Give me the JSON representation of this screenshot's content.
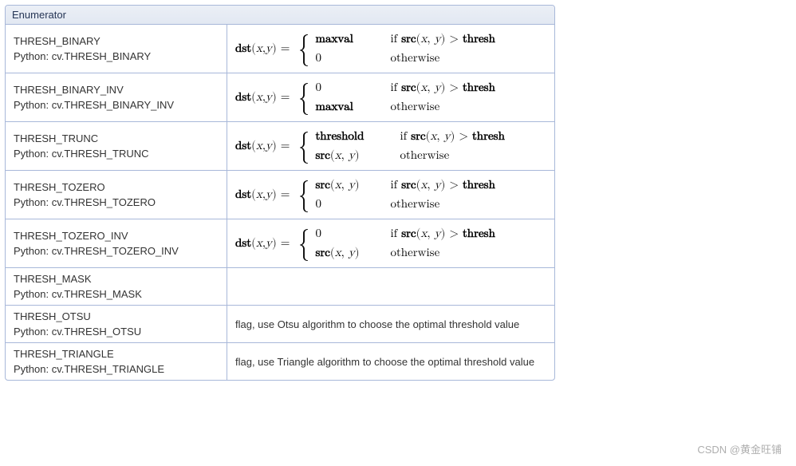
{
  "header": "Enumerator",
  "rows": [
    {
      "name": "THRESH_BINARY",
      "python": "Python: cv.THRESH_BINARY",
      "formula": {
        "lhs": "dst(x, y) = ",
        "case1_val": "maxval",
        "case1_val_bold": true,
        "case1_cond": "if src(x, y) > thresh",
        "case2_val": "0",
        "case2_val_bold": false,
        "case2_cond": "otherwise",
        "wide": false
      }
    },
    {
      "name": "THRESH_BINARY_INV",
      "python": "Python: cv.THRESH_BINARY_INV",
      "formula": {
        "lhs": "dst(x, y) = ",
        "case1_val": "0",
        "case1_val_bold": false,
        "case1_cond": "if src(x, y) > thresh",
        "case2_val": "maxval",
        "case2_val_bold": true,
        "case2_cond": "otherwise",
        "wide": false
      }
    },
    {
      "name": "THRESH_TRUNC",
      "python": "Python: cv.THRESH_TRUNC",
      "formula": {
        "lhs": "dst(x, y) = ",
        "case1_val": "threshold",
        "case1_val_bold": true,
        "case1_cond": "if src(x, y) > thresh",
        "case2_val": "src(x, y)",
        "case2_val_bold": true,
        "case2_cond": "otherwise",
        "wide": true
      }
    },
    {
      "name": "THRESH_TOZERO",
      "python": "Python: cv.THRESH_TOZERO",
      "formula": {
        "lhs": "dst(x, y) = ",
        "case1_val": "src(x, y)",
        "case1_val_bold": true,
        "case1_cond": "if src(x, y) > thresh",
        "case2_val": "0",
        "case2_val_bold": false,
        "case2_cond": "otherwise",
        "wide": false
      }
    },
    {
      "name": "THRESH_TOZERO_INV",
      "python": "Python: cv.THRESH_TOZERO_INV",
      "formula": {
        "lhs": "dst(x, y) = ",
        "case1_val": "0",
        "case1_val_bold": false,
        "case1_cond": "if src(x, y) > thresh",
        "case2_val": "src(x, y)",
        "case2_val_bold": true,
        "case2_cond": "otherwise",
        "wide": false
      }
    },
    {
      "name": "THRESH_MASK",
      "python": "Python: cv.THRESH_MASK",
      "desc": ""
    },
    {
      "name": "THRESH_OTSU",
      "python": "Python: cv.THRESH_OTSU",
      "desc": "flag, use Otsu algorithm to choose the optimal threshold value"
    },
    {
      "name": "THRESH_TRIANGLE",
      "python": "Python: cv.THRESH_TRIANGLE",
      "desc": "flag, use Triangle algorithm to choose the optimal threshold value"
    }
  ],
  "watermark": "CSDN @黄金旺铺"
}
